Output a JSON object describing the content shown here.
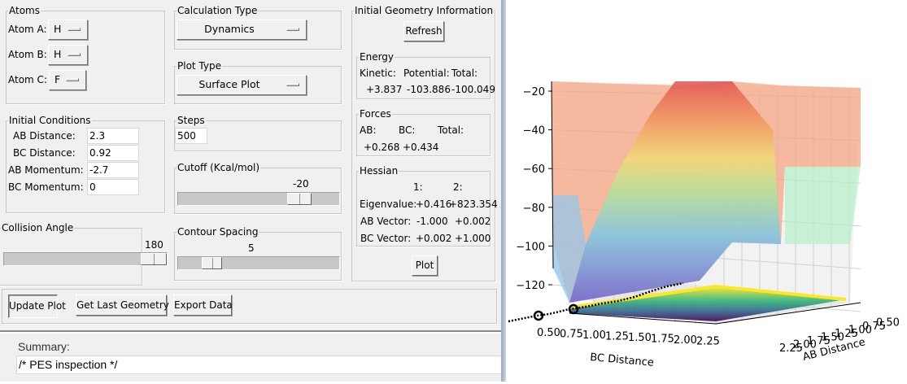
{
  "atoms": {
    "title": "Atoms",
    "rows": [
      {
        "label": "Atom A:",
        "value": "H"
      },
      {
        "label": "Atom B:",
        "value": "H"
      },
      {
        "label": "Atom C:",
        "value": "F"
      }
    ]
  },
  "initial_conditions": {
    "title": "Initial Conditions",
    "rows": [
      {
        "label": "AB Distance:",
        "value": "2.3"
      },
      {
        "label": "BC Distance:",
        "value": "0.92"
      },
      {
        "label": "AB Momentum:",
        "value": "-2.7"
      },
      {
        "label": "BC Momentum:",
        "value": "0"
      }
    ]
  },
  "collision_angle": {
    "title": "Collision Angle",
    "value": "180",
    "fraction": 1.0
  },
  "calculation_type": {
    "title": "Calculation Type",
    "value": "Dynamics"
  },
  "plot_type": {
    "title": "Plot Type",
    "value": "Surface Plot"
  },
  "steps": {
    "title": "Steps",
    "value": "500"
  },
  "cutoff": {
    "title": "Cutoff (Kcal/mol)",
    "value": "-20",
    "fraction": 0.8
  },
  "contour_spacing": {
    "title": "Contour Spacing",
    "value": "5",
    "fraction": 0.2
  },
  "geometry": {
    "title": "Initial Geometry Information",
    "refresh": "Refresh",
    "plot": "Plot",
    "energy": {
      "title": "Energy",
      "headers": [
        "Kinetic:",
        "Potential:",
        "Total:"
      ],
      "values": [
        "+3.837",
        "-103.886",
        "-100.049"
      ]
    },
    "forces": {
      "title": "Forces",
      "headers": [
        "AB:",
        "BC:",
        "Total:"
      ],
      "values": [
        "+0.268",
        "+0.434"
      ]
    },
    "hessian": {
      "title": "Hessian",
      "cols": [
        "1:",
        "2:"
      ],
      "rows": [
        {
          "label": "Eigenvalue:",
          "v1": "+0.416",
          "v2": "+823.354"
        },
        {
          "label": "AB Vector:",
          "v1": "-1.000",
          "v2": "+0.002"
        },
        {
          "label": "BC Vector:",
          "v1": "+0.002",
          "v2": "+1.000"
        }
      ]
    }
  },
  "toolbar": {
    "update": "Update Plot",
    "last_geometry": "Get Last Geometry",
    "export": "Export Data"
  },
  "summary": {
    "label": "Summary:",
    "value": "/* PES inspection */"
  },
  "chart_data": {
    "type": "surface",
    "zticks": [
      "−20",
      "−40",
      "−60",
      "−80",
      "−100",
      "−120"
    ],
    "xlabel": "BC Distance",
    "xticks": [
      "0.50",
      "0.75",
      "1.00",
      "1.25",
      "1.50",
      "1.75",
      "2.00",
      "2.25"
    ],
    "ylabel": "AB Distance",
    "yticks": [
      "2.25",
      "2.00",
      "1.75",
      "1.50",
      "1.25",
      "1.00",
      "0.75",
      "0.50"
    ]
  }
}
